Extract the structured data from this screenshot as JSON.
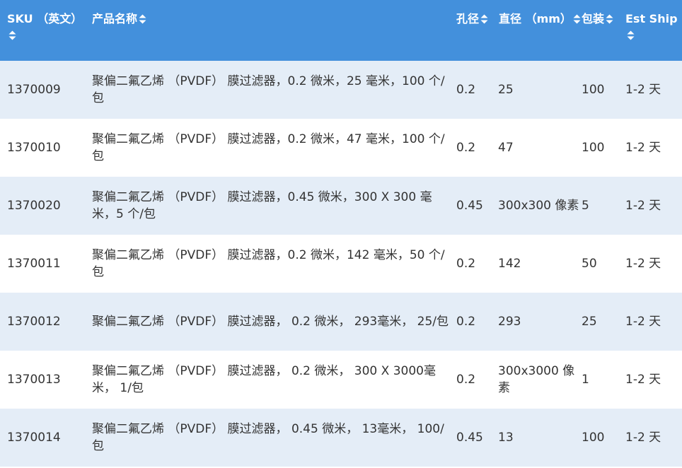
{
  "header": {
    "sku": "SKU （英文）",
    "name": "产品名称",
    "pore": "孔径",
    "diameter": "直径 （mm）",
    "package": "包装",
    "ship": "Est Ship"
  },
  "sort_icon": "sort-arrows-icon",
  "colors": {
    "header_bg": "#4390dc",
    "row_alt_bg": "#e4edf7",
    "row_bg": "#ffffff",
    "text": "#333333"
  },
  "rows": [
    {
      "sku": "1370009",
      "name": "聚偏二氟乙烯 （PVDF） 膜过滤器，0.2 微米，25 毫米，100 个/包",
      "pore": "0.2",
      "diameter": "25",
      "package": "100",
      "ship": "1-2 天"
    },
    {
      "sku": "1370010",
      "name": "聚偏二氟乙烯 （PVDF） 膜过滤器，0.2 微米，47 毫米，100 个/包",
      "pore": "0.2",
      "diameter": "47",
      "package": "100",
      "ship": "1-2 天"
    },
    {
      "sku": "1370020",
      "name": "聚偏二氟乙烯 （PVDF） 膜过滤器，0.45 微米，300 X 300 毫米，5 个/包",
      "pore": "0.45",
      "diameter": "300x300 像素",
      "package": "5",
      "ship": "1-2 天"
    },
    {
      "sku": "1370011",
      "name": "聚偏二氟乙烯 （PVDF） 膜过滤器，0.2 微米，142 毫米，50 个/包",
      "pore": "0.2",
      "diameter": "142",
      "package": "50",
      "ship": "1-2 天"
    },
    {
      "sku": "1370012",
      "name": "聚偏二氟乙烯 （PVDF） 膜过滤器， 0.2 微米， 293毫米， 25/包",
      "pore": "0.2",
      "diameter": "293",
      "package": "25",
      "ship": "1-2 天"
    },
    {
      "sku": "1370013",
      "name": "聚偏二氟乙烯 （PVDF） 膜过滤器， 0.2 微米， 300 X 3000毫米， 1/包",
      "pore": "0.2",
      "diameter": "300x3000 像素",
      "package": "1",
      "ship": "1-2 天"
    },
    {
      "sku": "1370014",
      "name": "聚偏二氟乙烯 （PVDF） 膜过滤器， 0.45 微米， 13毫米， 100/包",
      "pore": "0.45",
      "diameter": "13",
      "package": "100",
      "ship": "1-2 天"
    }
  ]
}
